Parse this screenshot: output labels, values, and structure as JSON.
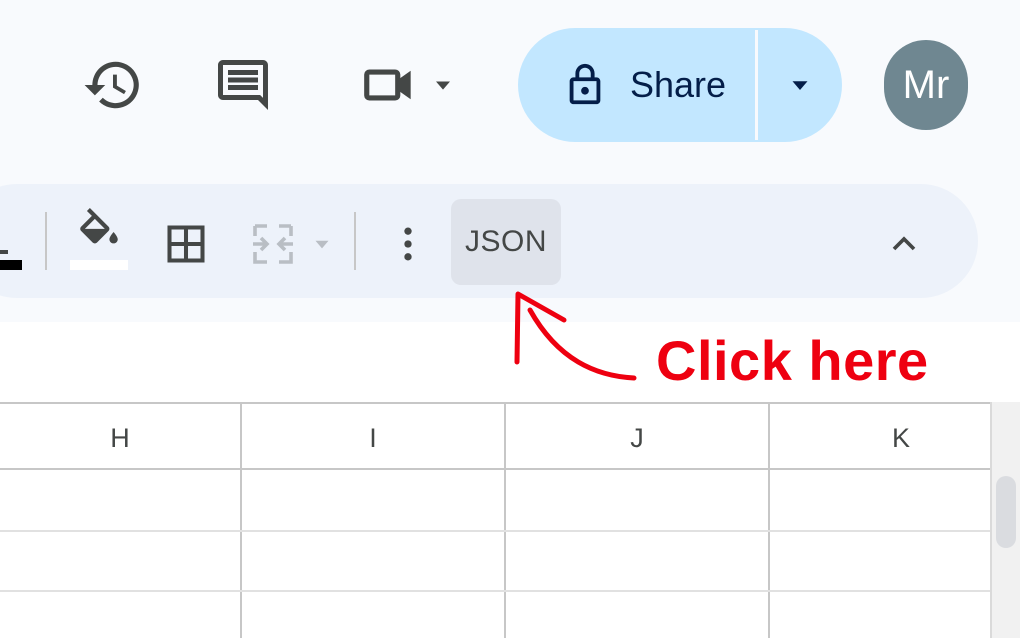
{
  "header": {
    "history_icon": "history-icon",
    "comments_icon": "comments-icon",
    "meet_icon": "video-call-icon",
    "share_label": "Share",
    "avatar_initials": "Mr"
  },
  "toolbar": {
    "buttons": [
      {
        "name": "text-color",
        "icon": "text-color-icon"
      },
      {
        "name": "fill-color",
        "icon": "paint-bucket-icon"
      },
      {
        "name": "borders",
        "icon": "borders-icon"
      },
      {
        "name": "merge-cells",
        "icon": "merge-cells-icon",
        "disabled": true
      },
      {
        "name": "more",
        "icon": "more-vert-icon"
      }
    ],
    "json_label": "JSON",
    "collapse_icon": "chevron-up-icon"
  },
  "annotation": {
    "text": "Click here",
    "color": "#ee0010"
  },
  "sheet": {
    "columns": [
      "H",
      "I",
      "J",
      "K"
    ]
  },
  "colors": {
    "background": "#f8fafd",
    "toolbar": "#edf2fa",
    "share_button": "#c2e7ff",
    "avatar": "#6f8791"
  }
}
